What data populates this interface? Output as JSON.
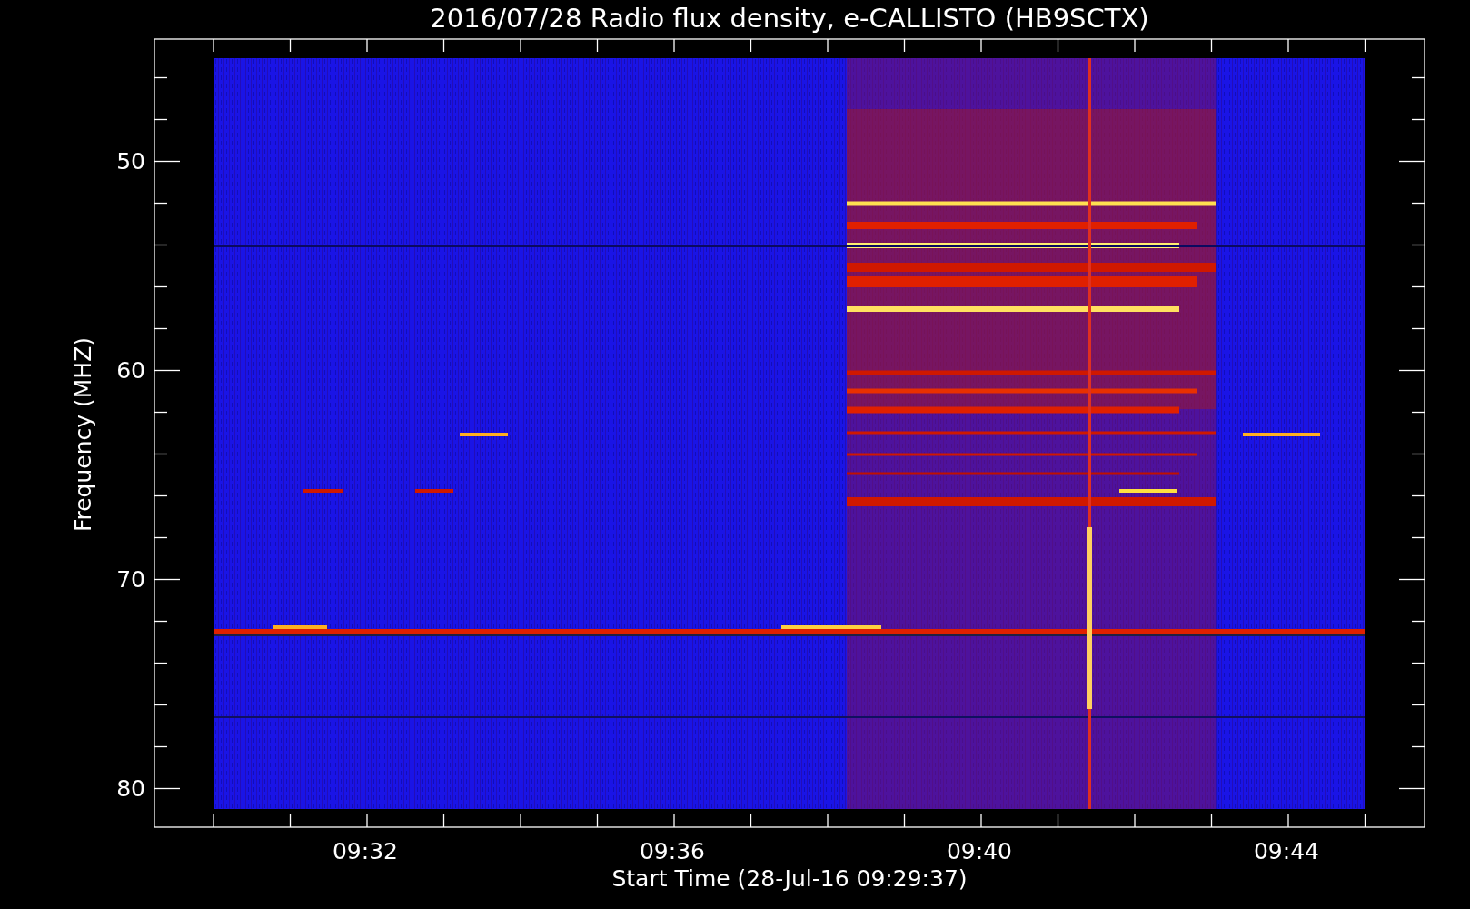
{
  "title": "2016/07/28  Radio flux density, e-CALLISTO (HB9SCTX)",
  "y_axis": {
    "label": "Frequency (MHZ)",
    "ticks": [
      "50",
      "60",
      "70",
      "80"
    ]
  },
  "x_axis": {
    "label": "Start Time (28-Jul-16 09:29:37)",
    "ticks": [
      "09:32",
      "09:36",
      "09:40",
      "09:44"
    ]
  }
}
